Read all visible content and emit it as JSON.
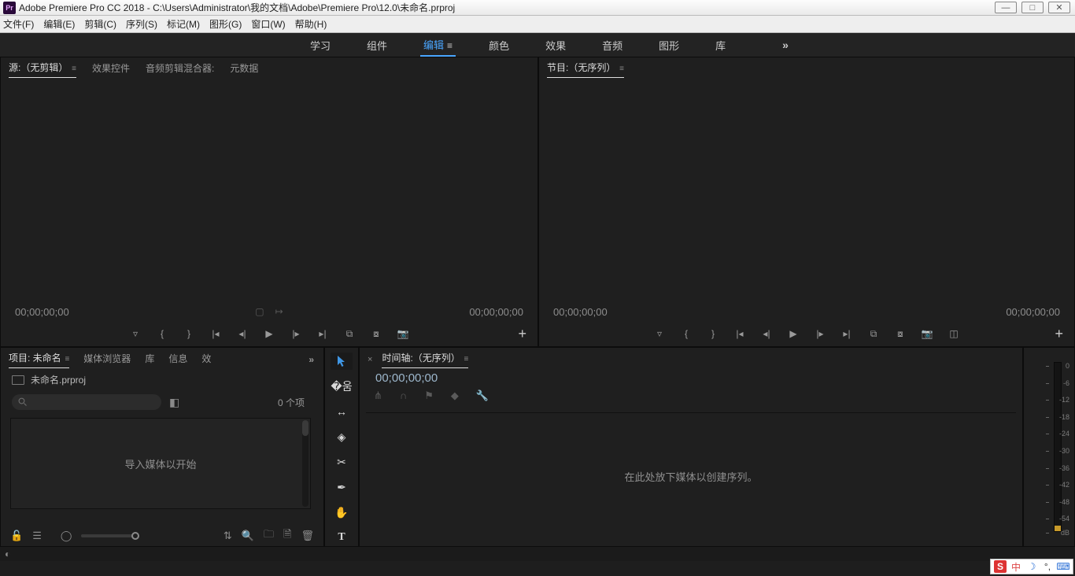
{
  "titlebar": {
    "icon_text": "Pr",
    "title": "Adobe Premiere Pro CC 2018 - C:\\Users\\Administrator\\我的文档\\Adobe\\Premiere Pro\\12.0\\未命名.prproj",
    "minimize": "—",
    "maximize": "□",
    "close": "✕"
  },
  "menu": {
    "file": "文件(F)",
    "edit": "编辑(E)",
    "clip": "剪辑(C)",
    "sequence": "序列(S)",
    "marker": "标记(M)",
    "graphics": "图形(G)",
    "window": "窗口(W)",
    "help": "帮助(H)"
  },
  "workspace": {
    "learn": "学习",
    "assembly": "组件",
    "editing": "编辑",
    "color": "颜色",
    "effects": "效果",
    "audio": "音频",
    "graphics": "图形",
    "library": "库",
    "more": "»"
  },
  "source": {
    "tab_source": "源:（无剪辑）",
    "tab_effect_controls": "效果控件",
    "tab_audio_mixer": "音频剪辑混合器:",
    "tab_metadata": "元数据",
    "tc_left": "00;00;00;00",
    "tc_right": "00;00;00;00"
  },
  "program": {
    "tab_program": "节目:（无序列）",
    "tc_left": "00;00;00;00",
    "tc_right": "00;00;00;00"
  },
  "project": {
    "tab_project": "项目: 未命名",
    "tab_media_browser": "媒体浏览器",
    "tab_library": "库",
    "tab_info": "信息",
    "tab_effects_short": "效",
    "more": "»",
    "file_name": "未命名.prproj",
    "count": "0 个项",
    "drop_hint": "导入媒体以开始"
  },
  "timeline": {
    "tab": "时间轴:（无序列）",
    "time": "00;00;00;00",
    "drop_hint": "在此处放下媒体以创建序列。"
  },
  "meter": {
    "ticks": [
      "0",
      "-6",
      "-12",
      "-18",
      "-24",
      "-30",
      "-36",
      "-42",
      "-48",
      "-54",
      "dB"
    ]
  },
  "tray": {
    "ime": "S",
    "lang": "中",
    "moon": "☽",
    "punc": "°,",
    "kb": "⌨"
  }
}
